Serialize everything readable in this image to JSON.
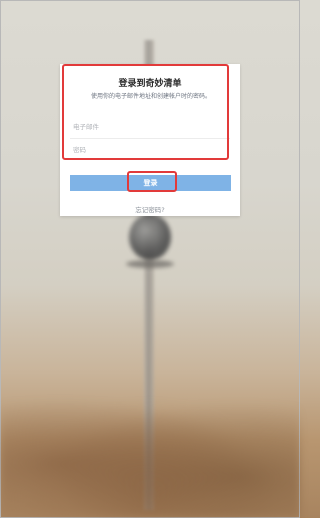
{
  "login": {
    "title": "登录到奇妙清单",
    "subtitle": "使用你的电子邮件地址和创建帐户时的密码。",
    "email_placeholder": "电子邮件",
    "password_placeholder": "密码",
    "login_button": "登录",
    "forgot_password": "忘记密码?"
  },
  "colors": {
    "highlight": "#e23a3a",
    "button": "#7fb3e6"
  }
}
